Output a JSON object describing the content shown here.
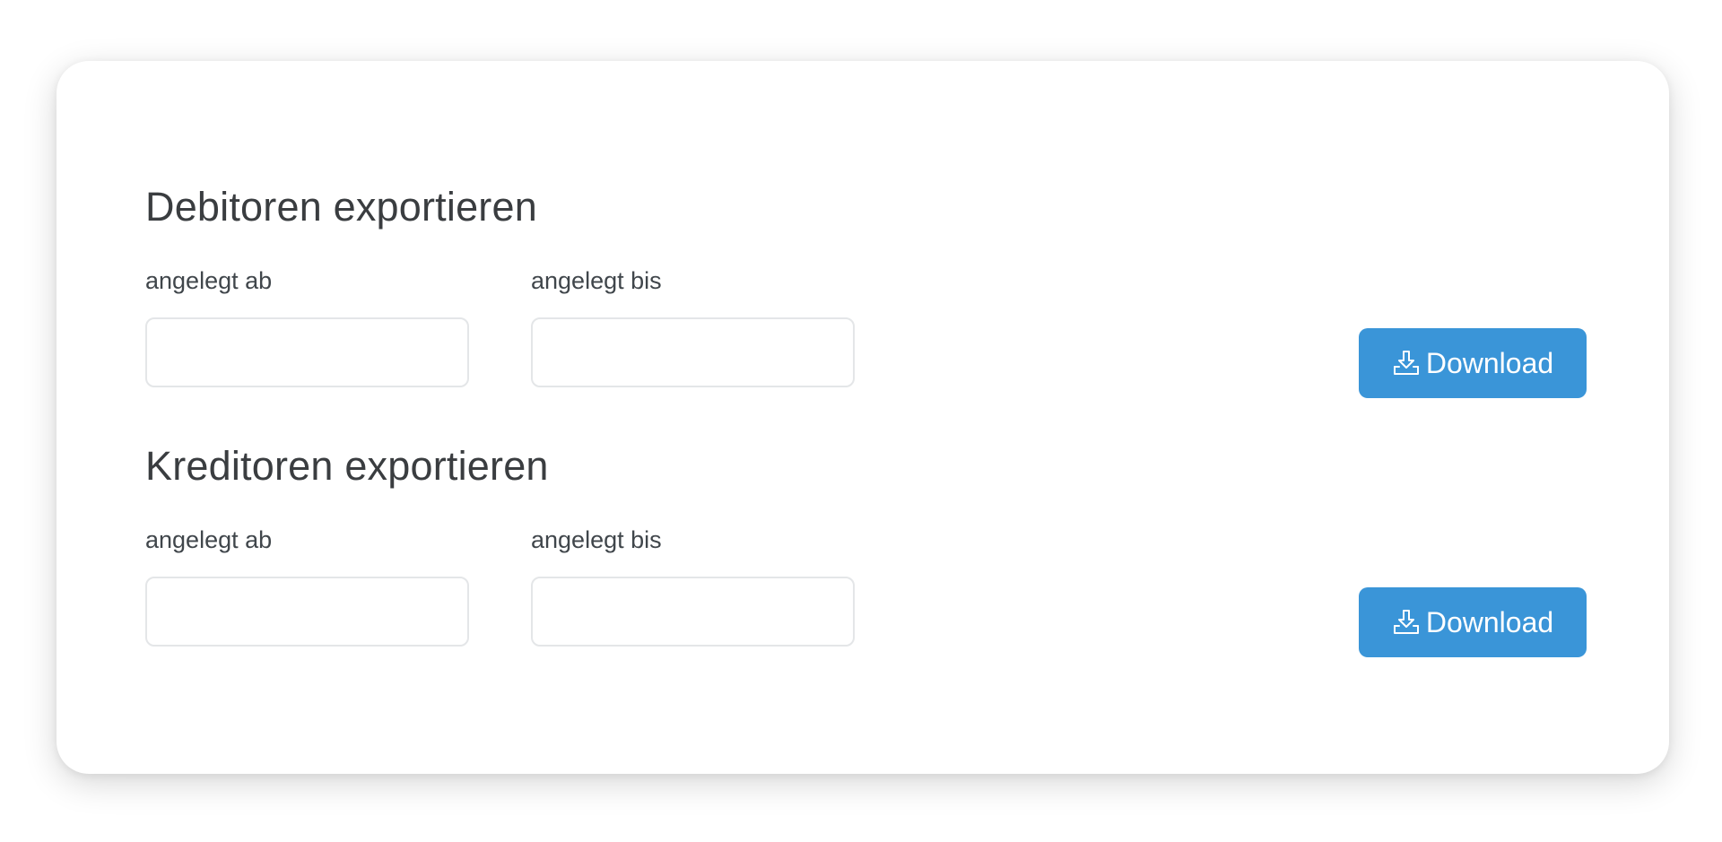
{
  "debitoren": {
    "title": "Debitoren exportieren",
    "from_label": "angelegt ab",
    "from_value": "",
    "to_label": "angelegt bis",
    "to_value": "",
    "download_label": "Download",
    "download_icon": "download-icon"
  },
  "kreditoren": {
    "title": "Kreditoren exportieren",
    "from_label": "angelegt ab",
    "from_value": "",
    "to_label": "angelegt bis",
    "to_value": "",
    "download_label": "Download",
    "download_icon": "download-icon"
  },
  "colors": {
    "accent": "#3a95d8",
    "text": "#3a3d40",
    "input_border": "#e4e6e8"
  }
}
